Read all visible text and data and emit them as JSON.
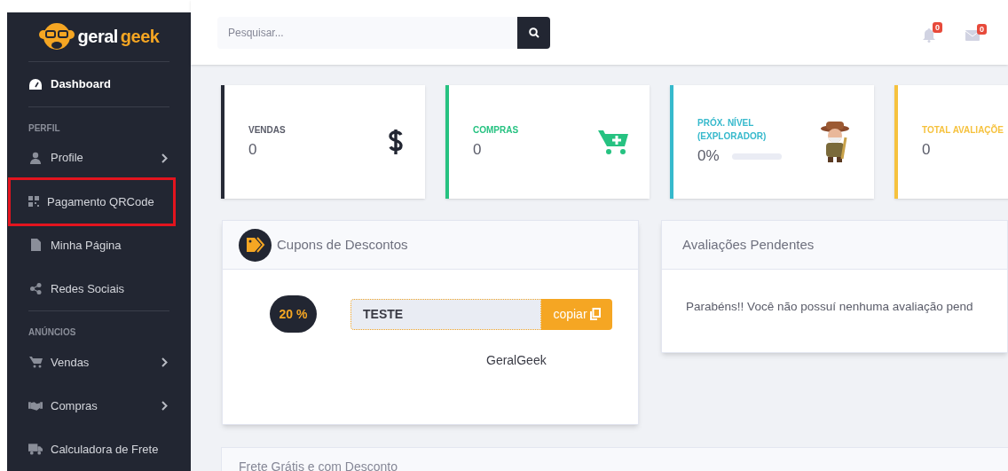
{
  "sidebar": {
    "logo": {
      "part_1": "geral",
      "part_2": "geek"
    },
    "sections": [
      {
        "items": [
          {
            "label": "Dashboard",
            "selected": true,
            "expandable": false,
            "highlighted": false
          }
        ]
      },
      {
        "heading": "PERFIL",
        "items": [
          {
            "label": "Profile",
            "selected": false,
            "expandable": true,
            "highlighted": false
          },
          {
            "label": "Pagamento QRCode",
            "selected": false,
            "expandable": false,
            "highlighted": true
          },
          {
            "label": "Minha Página",
            "selected": false,
            "expandable": false,
            "highlighted": false
          },
          {
            "label": "Redes Sociais",
            "selected": false,
            "expandable": false,
            "highlighted": false
          }
        ]
      },
      {
        "heading": "ANÚNCIOS",
        "items": [
          {
            "label": "Vendas",
            "selected": false,
            "expandable": true,
            "highlighted": false
          },
          {
            "label": "Compras",
            "selected": false,
            "expandable": true,
            "highlighted": false
          },
          {
            "label": "Calculadora de Frete",
            "selected": false,
            "expandable": false,
            "highlighted": false
          }
        ]
      }
    ]
  },
  "topbar": {
    "search": {
      "placeholder": "Pesquisar..."
    },
    "notifications": {
      "count": "0"
    },
    "messages": {
      "count": "0"
    }
  },
  "stats": [
    {
      "kind": "icon",
      "label": "VENDAS",
      "value": "0",
      "color": "#262a36"
    },
    {
      "kind": "icon",
      "label": "COMPRAS",
      "value": "0",
      "color": "#26c281"
    },
    {
      "kind": "progress",
      "label": "PRÓX. NÍVEL (EXPLORADOR)",
      "value": "0%",
      "level": 0,
      "color": "#36b9cc"
    },
    {
      "kind": "plain",
      "label": "TOTAL AVALIAÇÕE",
      "value": "0",
      "color": "#f6c23e"
    }
  ],
  "coupons_panel": {
    "title": "Cupons de Descontos",
    "coupons": [
      {
        "discount": "20 %",
        "code": "TESTE",
        "copy_label": "copiar",
        "store": "GeralGeek"
      }
    ]
  },
  "reviews_panel": {
    "title": "Avaliações Pendentes",
    "message": "Parabéns!! Você não possuí nenhuma avaliação pend"
  },
  "shipping_panel": {
    "title": "Frete Grátis e com Desconto"
  }
}
